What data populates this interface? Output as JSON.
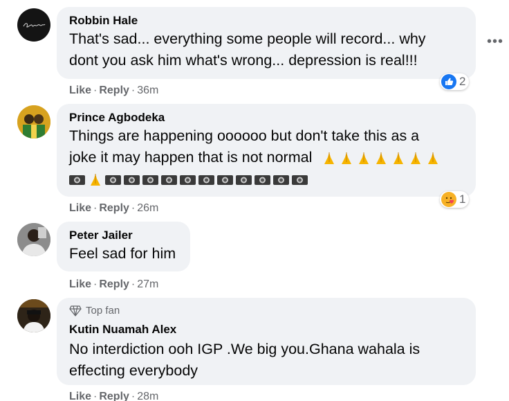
{
  "comments": [
    {
      "name": "Robbin Hale",
      "avatar_text": "Robbin Hale",
      "text": "That's sad... everything some people will record... why dont you ask him what's wrong... depression is real!!!",
      "actions": {
        "like": "Like",
        "reply": "Reply",
        "time": "36m"
      },
      "reaction": {
        "icon": "like-icon",
        "count": "2"
      }
    },
    {
      "name": "Prince Agbodeka",
      "text_line1": "Things are happening oooooo but don't take this as a",
      "text_line2": "joke it may happen that is not normal",
      "actions": {
        "like": "Like",
        "reply": "Reply",
        "time": "26m"
      },
      "reaction": {
        "icon": "care-icon",
        "count": "1"
      }
    },
    {
      "name": "Peter Jailer",
      "text": "Feel sad for him",
      "actions": {
        "like": "Like",
        "reply": "Reply",
        "time": "27m"
      }
    },
    {
      "badge": "Top fan",
      "name": "Kutin Nuamah Alex",
      "text": "No interdiction ooh IGP .We big you.Ghana wahala is effecting everybody",
      "actions": {
        "like": "Like",
        "reply": "Reply",
        "time": "28m"
      }
    }
  ],
  "colors": {
    "bubble": "#f0f2f5",
    "meta": "#65676b",
    "like_blue": "#1877f2"
  }
}
